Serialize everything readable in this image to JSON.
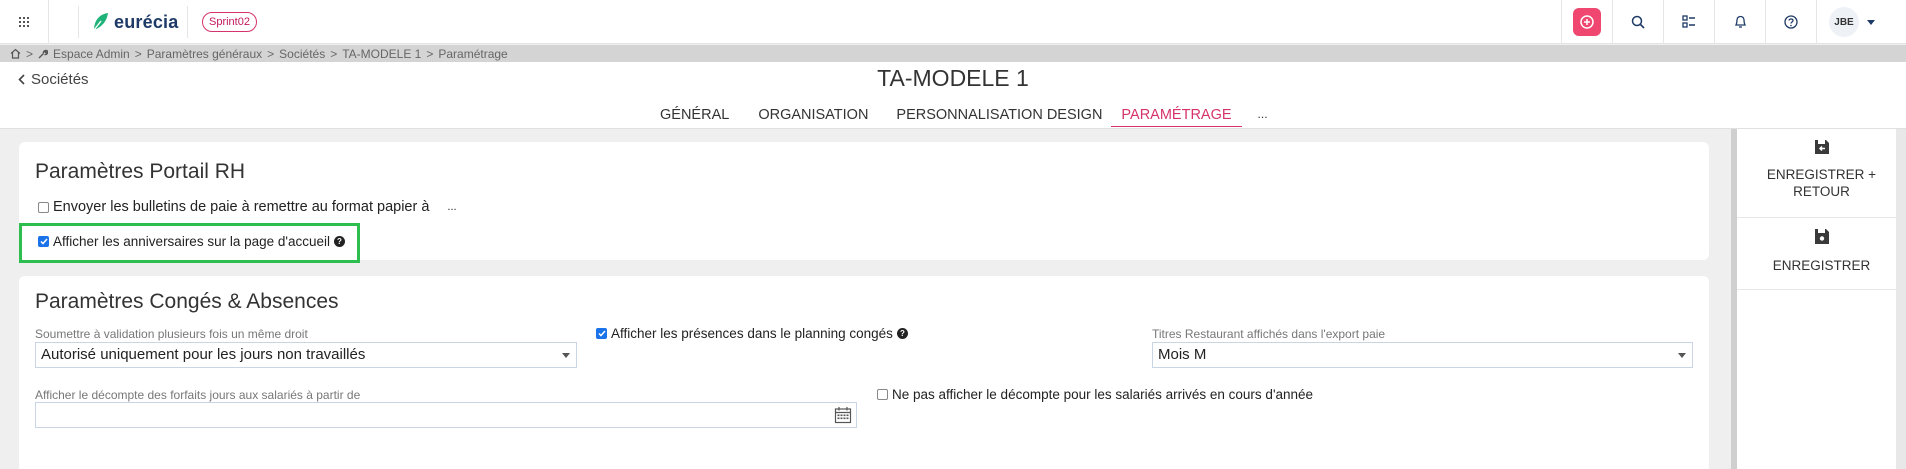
{
  "topbar": {
    "logo_text": "eurécia",
    "sprint_badge": "Sprint02",
    "user_initials": "JBE",
    "accent_color": "#ef4770"
  },
  "breadcrumb": {
    "items": [
      "Espace Admin",
      "Paramètres généraux",
      "Sociétés",
      "TA-MODELE 1",
      "Paramétrage"
    ]
  },
  "header": {
    "back_label": "Sociétés",
    "title": "TA-MODELE 1",
    "tabs": [
      {
        "label": "GÉNÉRAL"
      },
      {
        "label": "ORGANISATION"
      },
      {
        "label": "PERSONNALISATION DESIGN"
      },
      {
        "label": "PARAMÉTRAGE"
      },
      {
        "label": "..."
      }
    ]
  },
  "portail": {
    "title": "Paramètres Portail RH",
    "bulletins_label": "Envoyer les bulletins de paie à remettre au format papier à",
    "bulletins_ellipsis": "...",
    "bulletins_checked": false,
    "anniversaires_label": "Afficher les anniversaires sur la page d'accueil",
    "anniversaires_checked": true
  },
  "conges": {
    "title": "Paramètres Congés & Absences",
    "validation_label": "Soumettre à validation plusieurs fois un même droit",
    "validation_value": "Autorisé uniquement pour les jours non travaillés",
    "presences_label": "Afficher les présences dans le planning congés",
    "presences_checked": true,
    "titres_label": "Titres Restaurant affichés dans l'export paie",
    "titres_value": "Mois M",
    "forfaits_label": "Afficher le décompte des forfaits jours aux salariés à partir de",
    "forfaits_value": "",
    "ne_pas_afficher_label": "Ne pas afficher le décompte pour les salariés arrivés en cours d'année",
    "ne_pas_afficher_checked": false
  },
  "actions": {
    "save_return_label": "ENREGISTRER + RETOUR",
    "save_label": "ENREGISTRER"
  },
  "help_glyph": "?"
}
